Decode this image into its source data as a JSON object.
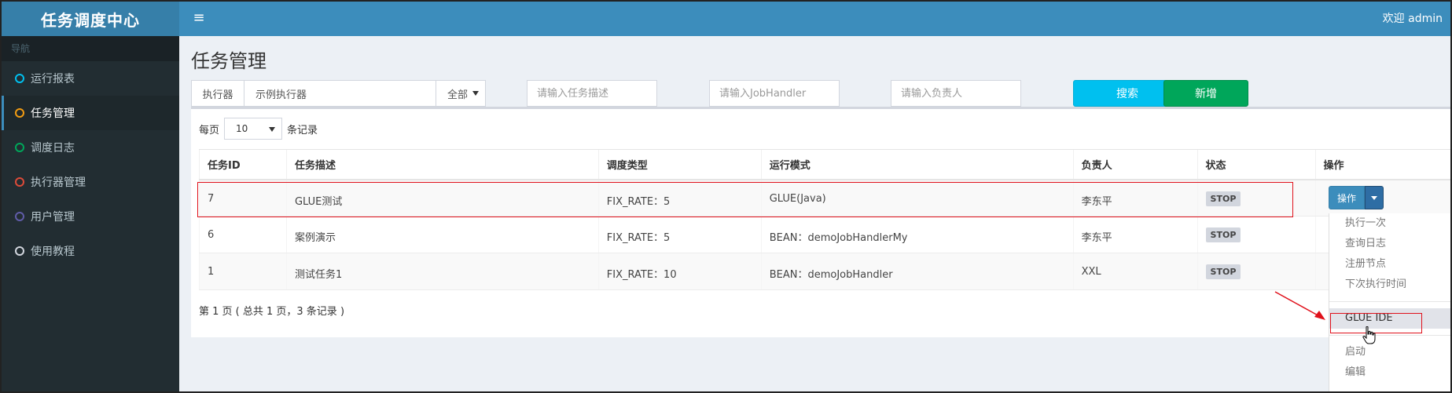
{
  "app": {
    "logo": "任务调度中心",
    "menu_toggle": "≡",
    "welcome": "欢迎 admin"
  },
  "sidebar": {
    "header": "导航",
    "items": [
      {
        "label": "运行报表",
        "color": "#00c0ef"
      },
      {
        "label": "任务管理",
        "color": "#f39c12"
      },
      {
        "label": "调度日志",
        "color": "#00a65a"
      },
      {
        "label": "执行器管理",
        "color": "#dd4b39"
      },
      {
        "label": "用户管理",
        "color": "#605ca8"
      },
      {
        "label": "使用教程",
        "color": "#d2d6de"
      }
    ]
  },
  "page": {
    "title": "任务管理"
  },
  "filters": {
    "executor_label": "执行器",
    "executor_value": "示例执行器",
    "status_value": "全部",
    "desc_placeholder": "请输入任务描述",
    "handler_placeholder": "请输入JobHandler",
    "author_placeholder": "请输入负责人",
    "search_label": "搜索",
    "add_label": "新增"
  },
  "perpage": {
    "prefix": "每页",
    "value": "10",
    "suffix": "条记录"
  },
  "table": {
    "headers": [
      "任务ID",
      "任务描述",
      "调度类型",
      "运行模式",
      "负责人",
      "状态",
      "操作"
    ],
    "rows": [
      {
        "id": "7",
        "desc": "GLUE测试",
        "sched": "FIX_RATE：5",
        "mode": "GLUE(Java)",
        "author": "李东平",
        "status": "STOP"
      },
      {
        "id": "6",
        "desc": "案例演示",
        "sched": "FIX_RATE：5",
        "mode": "BEAN：demoJobHandlerMy",
        "author": "李东平",
        "status": "STOP"
      },
      {
        "id": "1",
        "desc": "测试任务1",
        "sched": "FIX_RATE：10",
        "mode": "BEAN：demoJobHandler",
        "author": "XXL",
        "status": "STOP"
      }
    ]
  },
  "pager": {
    "text": "第 1 页 ( 总共 1 页，3 条记录 )"
  },
  "operation": {
    "button_label": "操作",
    "menu": [
      "执行一次",
      "查询日志",
      "注册节点",
      "下次执行时间",
      "GLUE IDE",
      "启动",
      "编辑"
    ]
  },
  "annotation_color": "#e0111b"
}
